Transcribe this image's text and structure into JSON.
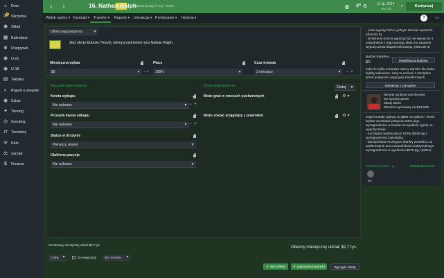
{
  "sidebar": {
    "items": [
      {
        "label": "Dom",
        "icon": "home-icon",
        "glyph": "⌂"
      },
      {
        "label": "Skrzynka",
        "icon": "inbox-icon",
        "glyph": "✉",
        "badge": "3"
      },
      {
        "label": "Skład",
        "icon": "squad-icon",
        "glyph": "◉"
      },
      {
        "label": "Kalendarz",
        "icon": "calendar-icon",
        "glyph": "▦"
      },
      {
        "label": "Rozgrywki",
        "icon": "trophy-icon",
        "glyph": "♛"
      },
      {
        "label": "U-21",
        "icon": "u21-icon",
        "glyph": "◉"
      },
      {
        "label": "U-18",
        "icon": "u18-icon",
        "glyph": "◉"
      },
      {
        "label": "Taktyka",
        "icon": "tactics-icon",
        "glyph": "▤"
      },
      {
        "label": "Raport o zespole",
        "icon": "report-icon",
        "glyph": "◐"
      },
      {
        "label": "Sztab",
        "icon": "staff-icon",
        "glyph": "◉"
      },
      {
        "label": "Trening",
        "icon": "training-icon",
        "glyph": "✦"
      },
      {
        "label": "Scouting",
        "icon": "scouting-icon",
        "glyph": "◎"
      },
      {
        "label": "Transfery",
        "icon": "transfers-icon",
        "glyph": "⇄"
      },
      {
        "label": "Klub",
        "icon": "club-icon",
        "glyph": "⛨"
      },
      {
        "label": "Zarząd",
        "icon": "board-icon",
        "glyph": "⚖"
      },
      {
        "label": "Finanse",
        "icon": "finance-icon",
        "glyph": "$"
      }
    ]
  },
  "header": {
    "title": "16. Nathan Ralph",
    "subtitle": "Obrońca (Lewy) / P (L) - Yeovil",
    "date": "11 lip. 2014",
    "time": "Pią 9:00",
    "continue_label": "Kontynuuj",
    "help": "?",
    "colors": {
      "green": "#3d8a4a",
      "sidebar": "#222a30"
    }
  },
  "subnav": {
    "tabs": [
      "Widok ogólny",
      "Kontrakt",
      "Transfer",
      "Raporty",
      "Interakcja",
      "Porównanie",
      "Historia"
    ]
  },
  "offer": {
    "type_select": "Oferta wyprzedzenia",
    "message": "Złóż ofertę klubowi (Yeovil), której przedmiotem jest Nathan Ralph.",
    "monthly_label": "Miesięczna opłata",
    "monthly_value": "$0",
    "installments_label": "Płace",
    "installments_value": "100%",
    "duration_label": "Czas trwania",
    "duration_value": "3 miesiące"
  },
  "clauses": {
    "left_title": "Klauzule wyprzedzenia",
    "right_title": "Opcje wyprzedzenia",
    "add_label": "Dodaj",
    "items_left": [
      {
        "label": "Kwota wykupu",
        "value": "Nie wybrano"
      },
      {
        "label": "Przyszła kwota odkupu",
        "value": "Nie wybrano"
      },
      {
        "label": "Status w drużynie",
        "value": "Pierwszy zespół"
      },
      {
        "label": "Ulubiona pozycja",
        "value": "Nie wybrano"
      }
    ],
    "items_right": [
      {
        "label": "Może grać w meczach pucharowych"
      },
      {
        "label": "Może zostać ściągnięty z powrotem"
      }
    ]
  },
  "footer": {
    "current_wage_small": "Oczekiwany miesięczny udział: $2,7 tys.",
    "current_wage_big": "Obecny miesięczny udział: $2,7 tys.",
    "withdraw_label": "Cofnij",
    "negotiable_label": "Do negocjacji",
    "no_deadline_label": "Bez terminu",
    "propose_label": "Złóż ofertę",
    "suggest_label": "Zaproponuj warunki",
    "clear_label": "Wyczyść ofertę"
  },
  "right_panel": {
    "rules": "- Limit wypożyczeń w jednym sezonie wynosi 8. (obecnie 0)\n- W sezonie można wypożyczyć nie więcej niż 4 zawodników z tego samego klubu na zasadzie wypożyczenia długoterminowego. (obecnie 0)",
    "budget_label": "Budżet transfero...",
    "budget_value": "$0",
    "budget_btn": "Modyfikacja budżetu",
    "budget_note": "Jako że byłby to bardzo ważny transfer dla klubu, byłoby wskazane, żeby to omówić z zarządem przed podjęciem negocjacji transferowych.",
    "board_btn": "Interakcja z zarządem",
    "player_status": "Nie jest na liście transferowej\nDo wypożyczenia\nMłody talent\nObecnie wyceniany na $18,50tk.",
    "contract_info": "Jego kontrakt opiewa na $625 na tydzień i Yeovil będzie oczekiwać pokrycia 100% jego wynagrodzenia w zamian za wysłanie zgody na wypożyczenie.\n- Accrington będzie płacić 100% ($625 tyg.) wynagrodzenia zawodnika.\n- Zarząd klubu Accrington Stanley zezwoli ci na zaoferowanie temu zawodnikowi maksymalnego wynagrodzenia w wysokości $675 tyg. (150%).",
    "scout_tab1": "Zainteresowanie - p...",
    "scout_tab2": "Zainteresowanie",
    "scout_name": "Inti"
  }
}
